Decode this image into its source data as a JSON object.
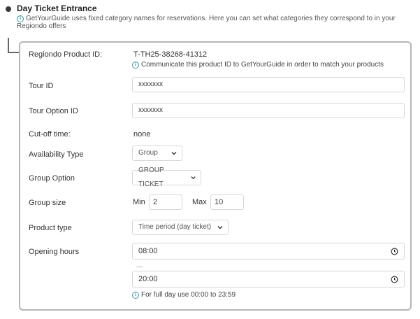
{
  "section": {
    "title": "Day Ticket Entrance",
    "description": "GetYourGuide uses fixed category names for reservations. Here you can set what categories they correspond to in your Regiondo offers"
  },
  "fields": {
    "product_id": {
      "label": "Regiondo Product ID:",
      "value": "T-TH25-38268-41312",
      "hint": "Communicate this product ID to GetYourGuide in order to match your products"
    },
    "tour_id": {
      "label": "Tour ID",
      "value": "xxxxxxx"
    },
    "tour_option_id": {
      "label": "Tour Option ID",
      "value": "xxxxxxx"
    },
    "cutoff": {
      "label": "Cut-off time:",
      "value": "none"
    },
    "availability_type": {
      "label": "Availability Type",
      "selected": "Group"
    },
    "group_option": {
      "label": "Group Option",
      "selected": "GROUP TICKET"
    },
    "group_size": {
      "label": "Group size",
      "min_label": "Min",
      "min_value": "2",
      "max_label": "Max",
      "max_value": "10"
    },
    "product_type": {
      "label": "Product type",
      "selected": "Time period (day ticket)"
    },
    "opening_hours": {
      "label": "Opening hours",
      "from": "08:00",
      "separator": "—",
      "to": "20:00",
      "hint": "For full day use 00:00 to 23:59"
    }
  },
  "colors": {
    "accent": "#3399aa",
    "border": "#b5b5b5"
  },
  "icons": [
    "info-icon",
    "chevron-down-icon",
    "clock-icon"
  ]
}
